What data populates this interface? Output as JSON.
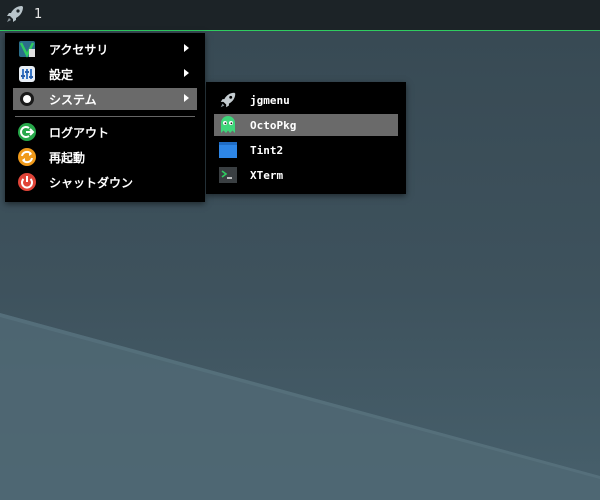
{
  "panel": {
    "workspace_label": "1",
    "accent_color": "#2fcc60",
    "launcher_icon": "rocket-icon"
  },
  "main_menu": {
    "items": [
      {
        "label": "アクセサリ",
        "icon": "accessories-icon",
        "has_submenu": true,
        "selected": false
      },
      {
        "label": "設定",
        "icon": "settings-icon",
        "has_submenu": true,
        "selected": false
      },
      {
        "label": "システム",
        "icon": "system-icon",
        "has_submenu": true,
        "selected": true
      },
      {
        "label": "ログアウト",
        "icon": "logout-icon",
        "has_submenu": false,
        "selected": false
      },
      {
        "label": "再起動",
        "icon": "restart-icon",
        "has_submenu": false,
        "selected": false
      },
      {
        "label": "シャットダウン",
        "icon": "shutdown-icon",
        "has_submenu": false,
        "selected": false
      }
    ]
  },
  "sub_menu": {
    "items": [
      {
        "label": "jgmenu",
        "icon": "rocket-icon",
        "selected": false
      },
      {
        "label": "OctoPkg",
        "icon": "octopkg-icon",
        "selected": true
      },
      {
        "label": "Tint2",
        "icon": "tint2-icon",
        "selected": false
      },
      {
        "label": "XTerm",
        "icon": "terminal-icon",
        "selected": false
      }
    ]
  },
  "colors": {
    "menu_background": "#000000",
    "selected_background": "#6a6a6a",
    "panel_background": "#1c2327"
  }
}
